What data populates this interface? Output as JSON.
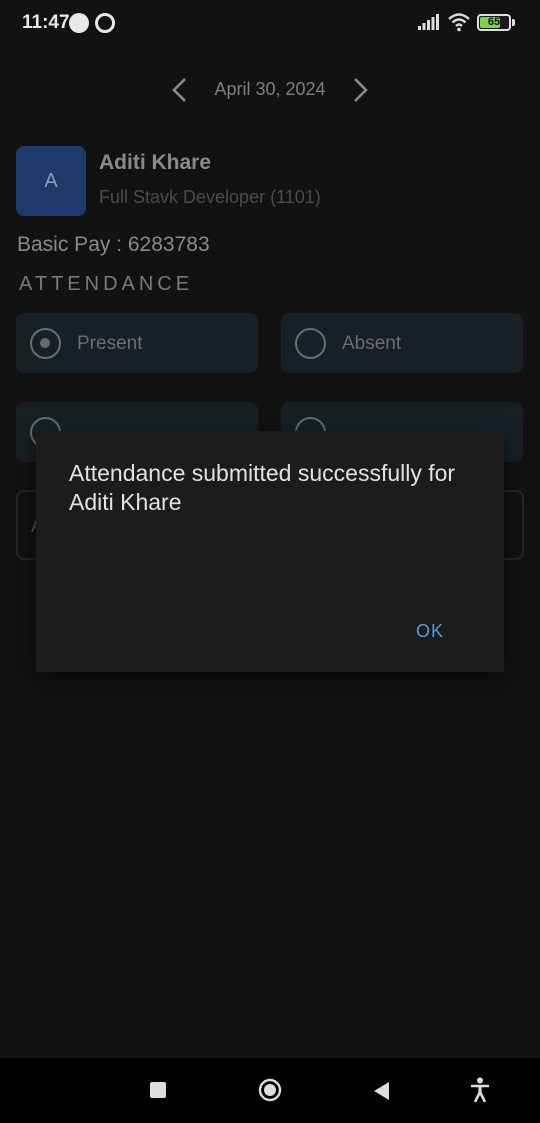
{
  "status_bar": {
    "time": "11:47",
    "battery_level": "65",
    "icons": [
      "app-notification-icon",
      "sync-notification-icon",
      "signal-icon",
      "wifi-icon",
      "battery-icon"
    ]
  },
  "date_nav": {
    "date": "April 30, 2024",
    "prev_icon": "chevron-left-icon",
    "next_icon": "chevron-right-icon"
  },
  "employee": {
    "avatar_initial": "A",
    "name": "Aditi Khare",
    "role": "Full Stavk Developer (1101)",
    "basic_pay": "Basic Pay : 6283783"
  },
  "attendance": {
    "title": "ATTENDANCE",
    "options": [
      {
        "label": "Present",
        "selected": true
      },
      {
        "label": "Absent",
        "selected": false
      }
    ]
  },
  "dialog": {
    "message": "Attendance submitted successfully for Aditi Khare",
    "ok_label": "OK"
  },
  "nav_bar": {
    "icons": [
      "recents-icon",
      "home-icon",
      "back-icon",
      "accessibility-icon"
    ]
  },
  "colors": {
    "background": "#121212",
    "card": "#172125",
    "avatar": "#1f3a6a",
    "dialog": "#1c1c1c",
    "accent": "#5b9bd5",
    "battery": "#7ed34b"
  }
}
